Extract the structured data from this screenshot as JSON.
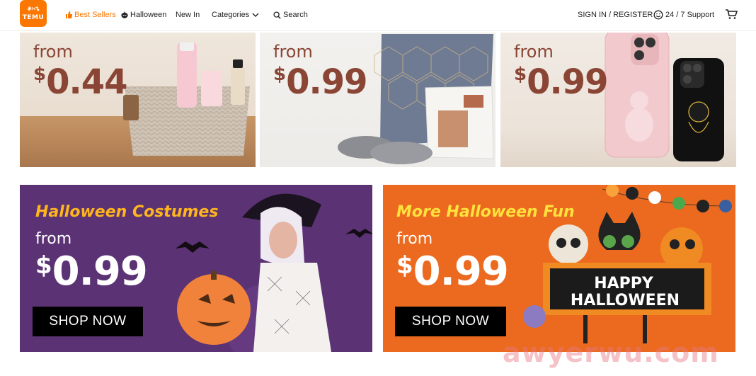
{
  "header": {
    "logo_line1": "ቆ፡‹ጌ",
    "logo_line2": "TEMU",
    "nav": {
      "best_sellers": "Best Sellers",
      "halloween": "Halloween",
      "new_in": "New In",
      "categories": "Categories",
      "search": "Search"
    },
    "sign_in": "SIGN IN / REGISTER",
    "support": "24 / 7 Support"
  },
  "tiles": [
    {
      "from": "from",
      "currency": "$",
      "price": "0.44"
    },
    {
      "from": "from",
      "currency": "$",
      "price": "0.99"
    },
    {
      "from": "from",
      "currency": "$",
      "price": "0.99"
    }
  ],
  "banners": [
    {
      "title": "Halloween Costumes",
      "from": "from",
      "currency": "$",
      "price": "0.99",
      "button": "SHOP NOW",
      "background": "#5b3374",
      "title_color": "#ffb51e"
    },
    {
      "title": "More Halloween Fun",
      "from": "from",
      "currency": "$",
      "price": "0.99",
      "button": "SHOP NOW",
      "background": "#ec6a1f",
      "title_color": "#ffe23d",
      "sign_text_1": "HAPPY",
      "sign_text_2": "HALLOWEEN"
    }
  ],
  "watermark": "awyerwu.com",
  "colors": {
    "brand": "#fb7701",
    "price_brown": "#8a4535"
  }
}
